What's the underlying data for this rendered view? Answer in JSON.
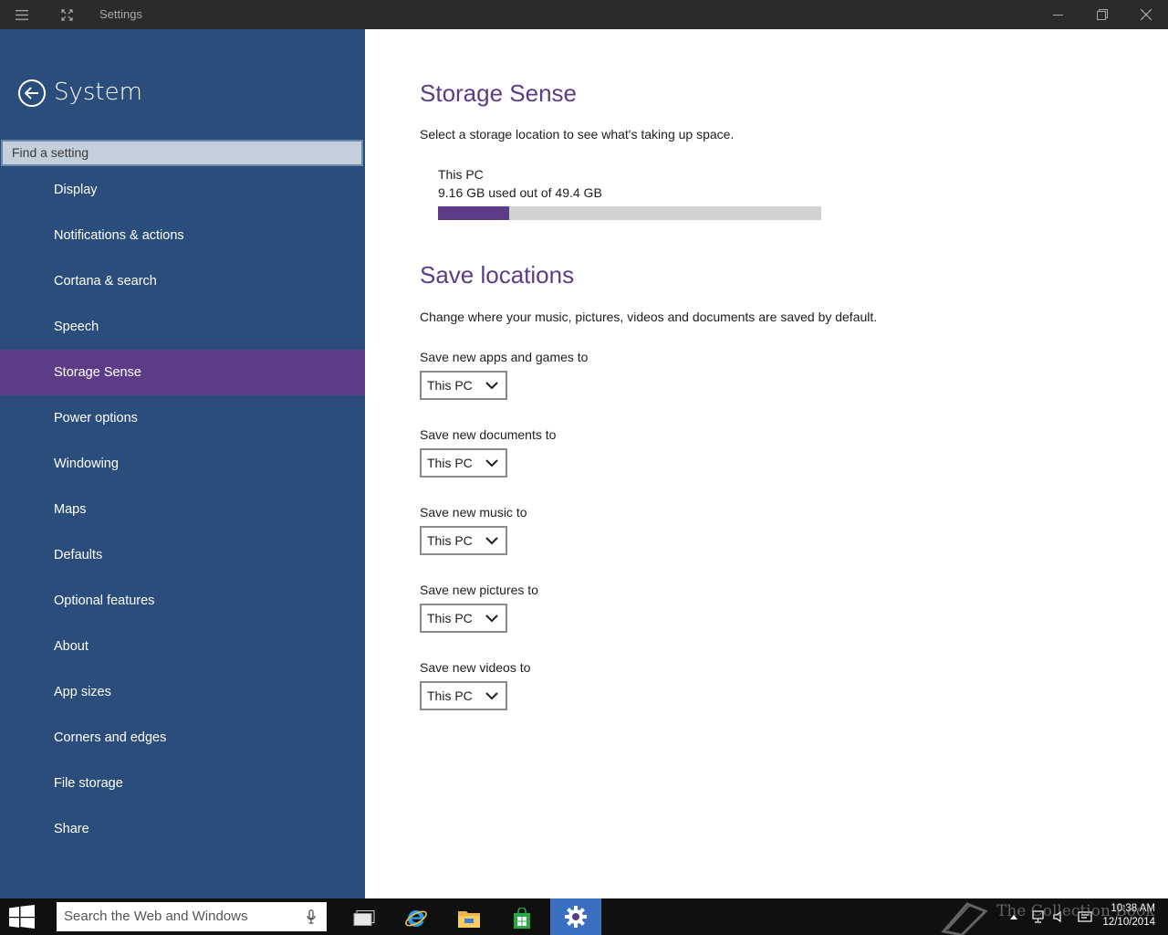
{
  "titlebar": {
    "title": "Settings"
  },
  "sidebar": {
    "title": "System",
    "search_placeholder": "Find a setting",
    "items": [
      {
        "label": "Display"
      },
      {
        "label": "Notifications & actions"
      },
      {
        "label": "Cortana & search"
      },
      {
        "label": "Speech"
      },
      {
        "label": "Storage Sense",
        "active": true
      },
      {
        "label": "Power options"
      },
      {
        "label": "Windowing"
      },
      {
        "label": "Maps"
      },
      {
        "label": "Defaults"
      },
      {
        "label": "Optional features"
      },
      {
        "label": "About"
      },
      {
        "label": "App sizes"
      },
      {
        "label": "Corners and edges"
      },
      {
        "label": "File storage"
      },
      {
        "label": "Share"
      }
    ]
  },
  "main": {
    "storage_heading": "Storage Sense",
    "storage_desc": "Select a storage location to see what's taking up space.",
    "drive": {
      "name": "This PC",
      "usage_text": "9.16 GB used out of 49.4 GB",
      "used_gb": 9.16,
      "total_gb": 49.4
    },
    "save_heading": "Save locations",
    "save_desc": "Change where your music, pictures, videos and documents are saved by default.",
    "save_fields": [
      {
        "label": "Save new apps and games to",
        "value": "This PC"
      },
      {
        "label": "Save new documents to",
        "value": "This PC"
      },
      {
        "label": "Save new music to",
        "value": "This PC"
      },
      {
        "label": "Save new pictures to",
        "value": "This PC"
      },
      {
        "label": "Save new videos to",
        "value": "This PC"
      }
    ]
  },
  "taskbar": {
    "search_placeholder": "Search the Web and Windows",
    "time": "10:38 AM",
    "date": "12/10/2014",
    "watermark": "The Collection Book"
  },
  "colors": {
    "accent": "#5d3c87",
    "sidebar": "#2a4d7b",
    "titlebar": "#2b2b2b",
    "taskbar": "#101010"
  }
}
